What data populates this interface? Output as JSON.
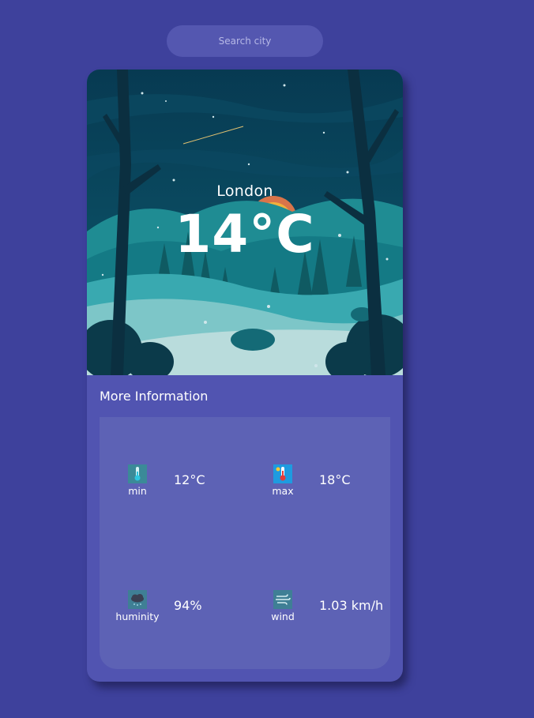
{
  "search": {
    "placeholder": "Search city"
  },
  "weather": {
    "city": "London",
    "temperature": "14°C"
  },
  "more_info": {
    "title": "More Information",
    "stats": [
      {
        "label": "min",
        "value": "12°C",
        "icon": "thermometer-cold-icon"
      },
      {
        "label": "max",
        "value": "18°C",
        "icon": "thermometer-hot-icon"
      },
      {
        "label": "huminity",
        "value": "94%",
        "icon": "cloud-humidity-icon"
      },
      {
        "label": "wind",
        "value": "1.03 km/h",
        "icon": "wind-icon"
      }
    ]
  },
  "colors": {
    "background": "#3e419c",
    "card": "#5154b1",
    "info_box": "#5d62b5",
    "search_box": "#5457b0"
  }
}
